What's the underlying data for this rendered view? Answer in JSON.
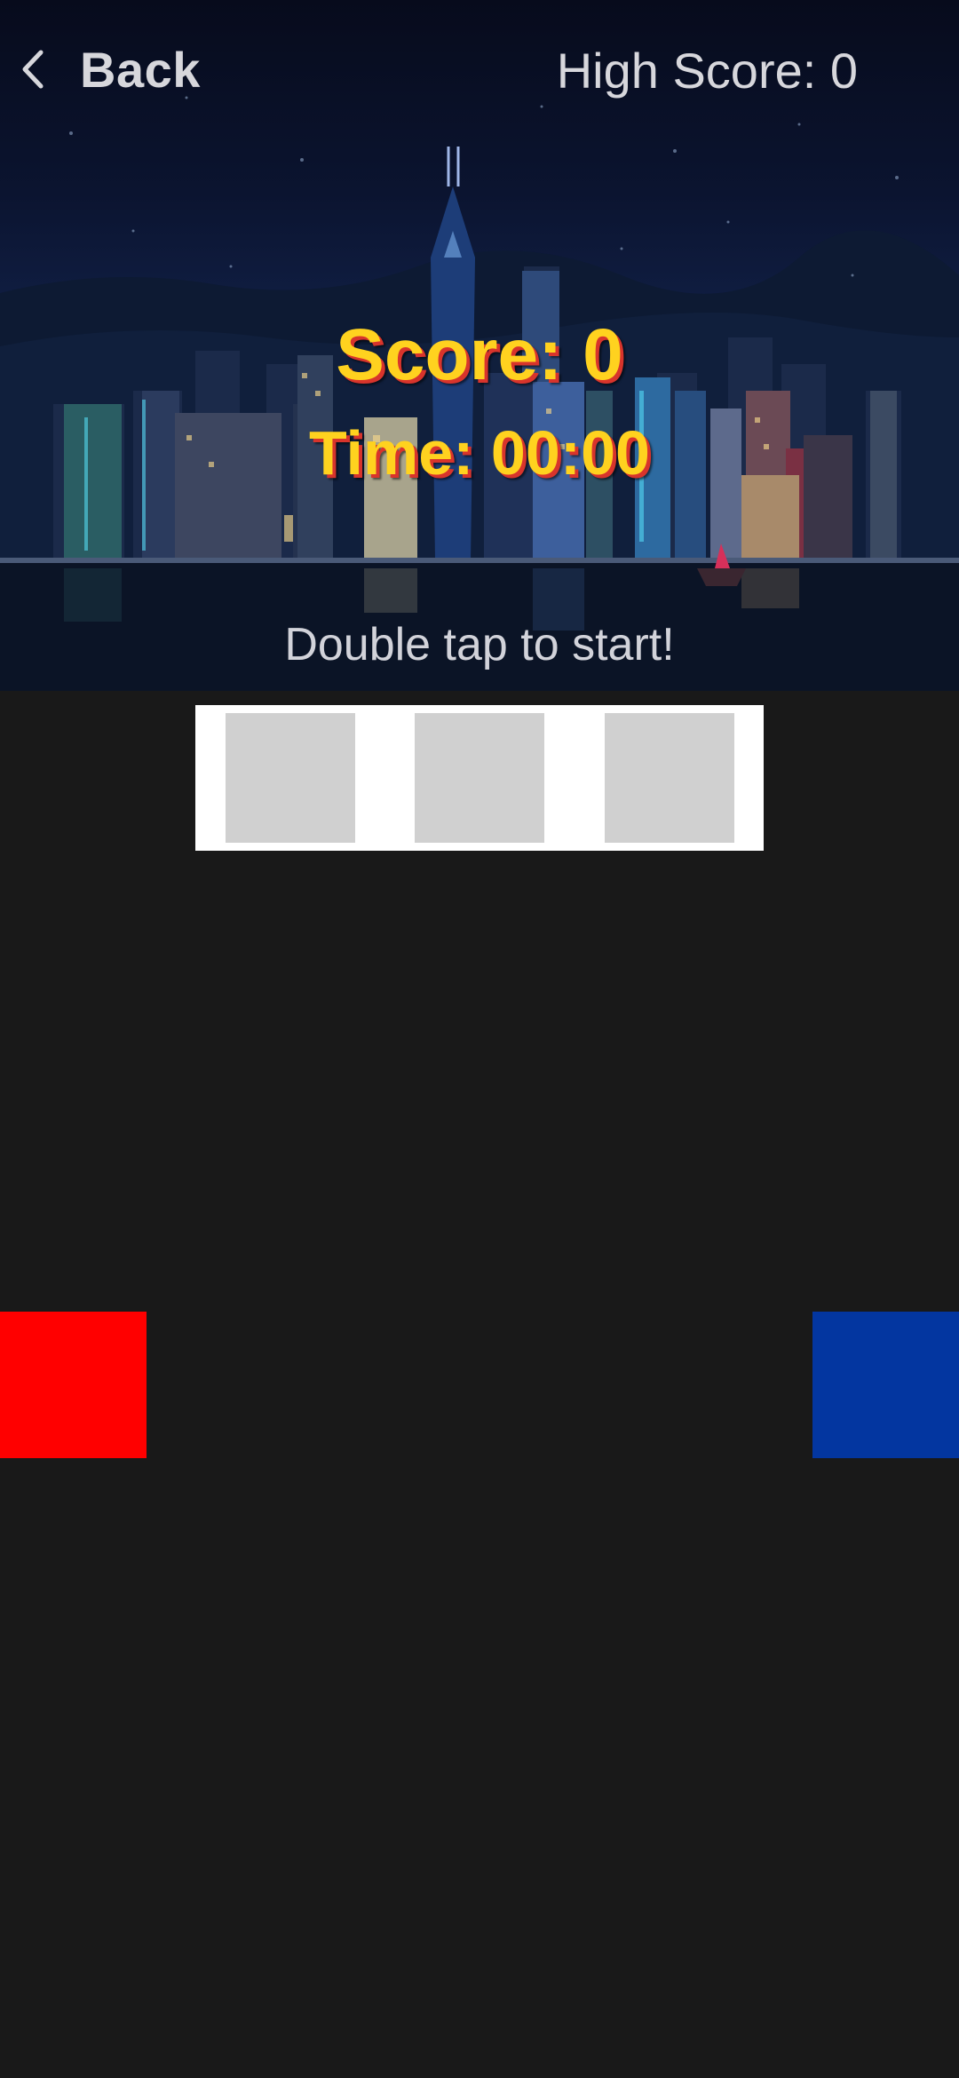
{
  "header": {
    "back_label": "Back",
    "high_score_label": "High Score: 0"
  },
  "hud": {
    "score_label": "Score: 0",
    "time_label": "Time: 00:00",
    "start_hint": "Double tap to start!"
  },
  "game": {
    "slots": 3,
    "left_block_color": "#ff0000",
    "right_block_color": "#0336a0"
  },
  "colors": {
    "background": "#191919",
    "hud_text": "#ffd21f",
    "hud_shadow": "#d8342c",
    "header_text": "#d7d7dc"
  },
  "icons": {
    "back": "chevron-left-icon"
  }
}
